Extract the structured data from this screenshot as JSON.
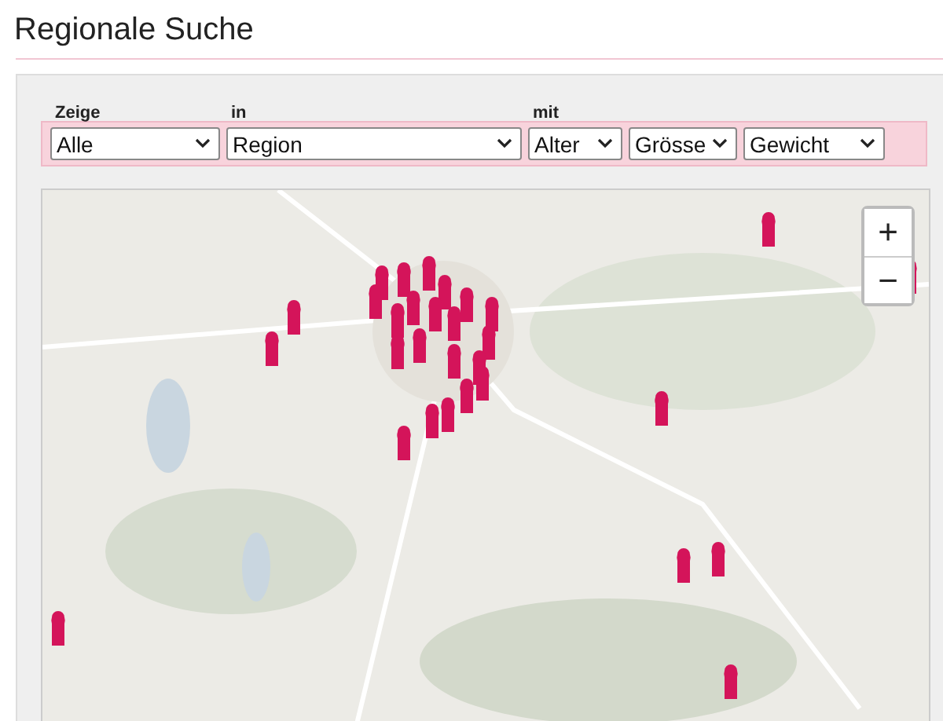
{
  "title": "Regionale Suche",
  "filters": [
    {
      "label": "Zeige",
      "value": "Alle"
    },
    {
      "label": "in",
      "value": "Region"
    },
    {
      "label": "mit",
      "value": "Alter"
    },
    {
      "value": "Grösse"
    },
    {
      "value": "Gewicht"
    }
  ],
  "map": {
    "kind": "picture",
    "zoom_in": "+",
    "zoom_out": "−"
  }
}
